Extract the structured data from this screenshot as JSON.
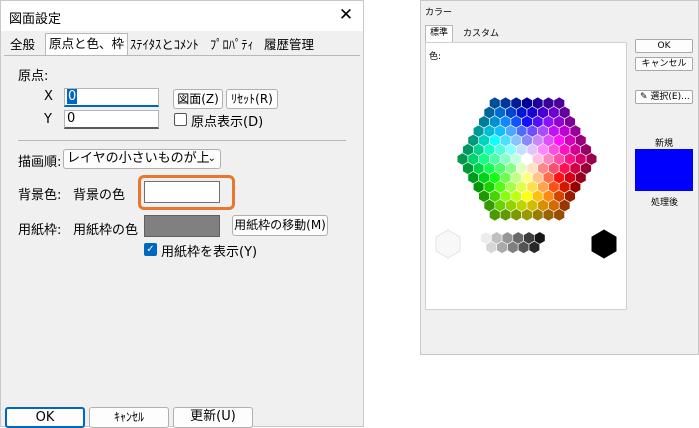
{
  "dialog1": {
    "title": "図面設定",
    "close_glyph": "✕",
    "tabs": [
      "全般",
      "原点と色、枠",
      "ｽﾃｲﾀｽとｺﾒﾝﾄ",
      "ﾌﾟﾛﾊﾟﾃｨ",
      "履歴管理"
    ],
    "active_tab": "原点と色、枠",
    "origin": {
      "heading": "原点:",
      "x_label": "X",
      "x_value": "0",
      "y_label": "Y",
      "y_value": "0",
      "drawing_button": "図面(Z)",
      "reset_button": "ﾘｾｯﾄ(R)",
      "show_origin_label": "原点表示(D)",
      "show_origin_checked": false
    },
    "draw_order": {
      "label": "描画順:",
      "value": "レイヤの小さいものが上"
    },
    "background": {
      "label": "背景色:",
      "value_label": "背景の色",
      "color": "#ffffff"
    },
    "paper_frame": {
      "label": "用紙枠:",
      "value_label": "用紙枠の色",
      "color": "#808080",
      "move_button": "用紙枠の移動(M)",
      "show_label": "用紙枠を表示(Y)",
      "show_checked": true
    },
    "buttons": {
      "ok": "OK",
      "cancel": "ｷｬﾝｾﾙ",
      "update": "更新(U)"
    },
    "highlight_color": "#e8762c"
  },
  "dialog2": {
    "title": "カラー",
    "tabs": [
      "標準",
      "カスタム"
    ],
    "active_tab": "標準",
    "colors_label": "色:",
    "ok_button": "OK",
    "cancel_button": "キャンセル",
    "select_button": "選択(E)...",
    "new_label": "新規",
    "current_label": "処理後",
    "new_color": "#0000ff"
  }
}
